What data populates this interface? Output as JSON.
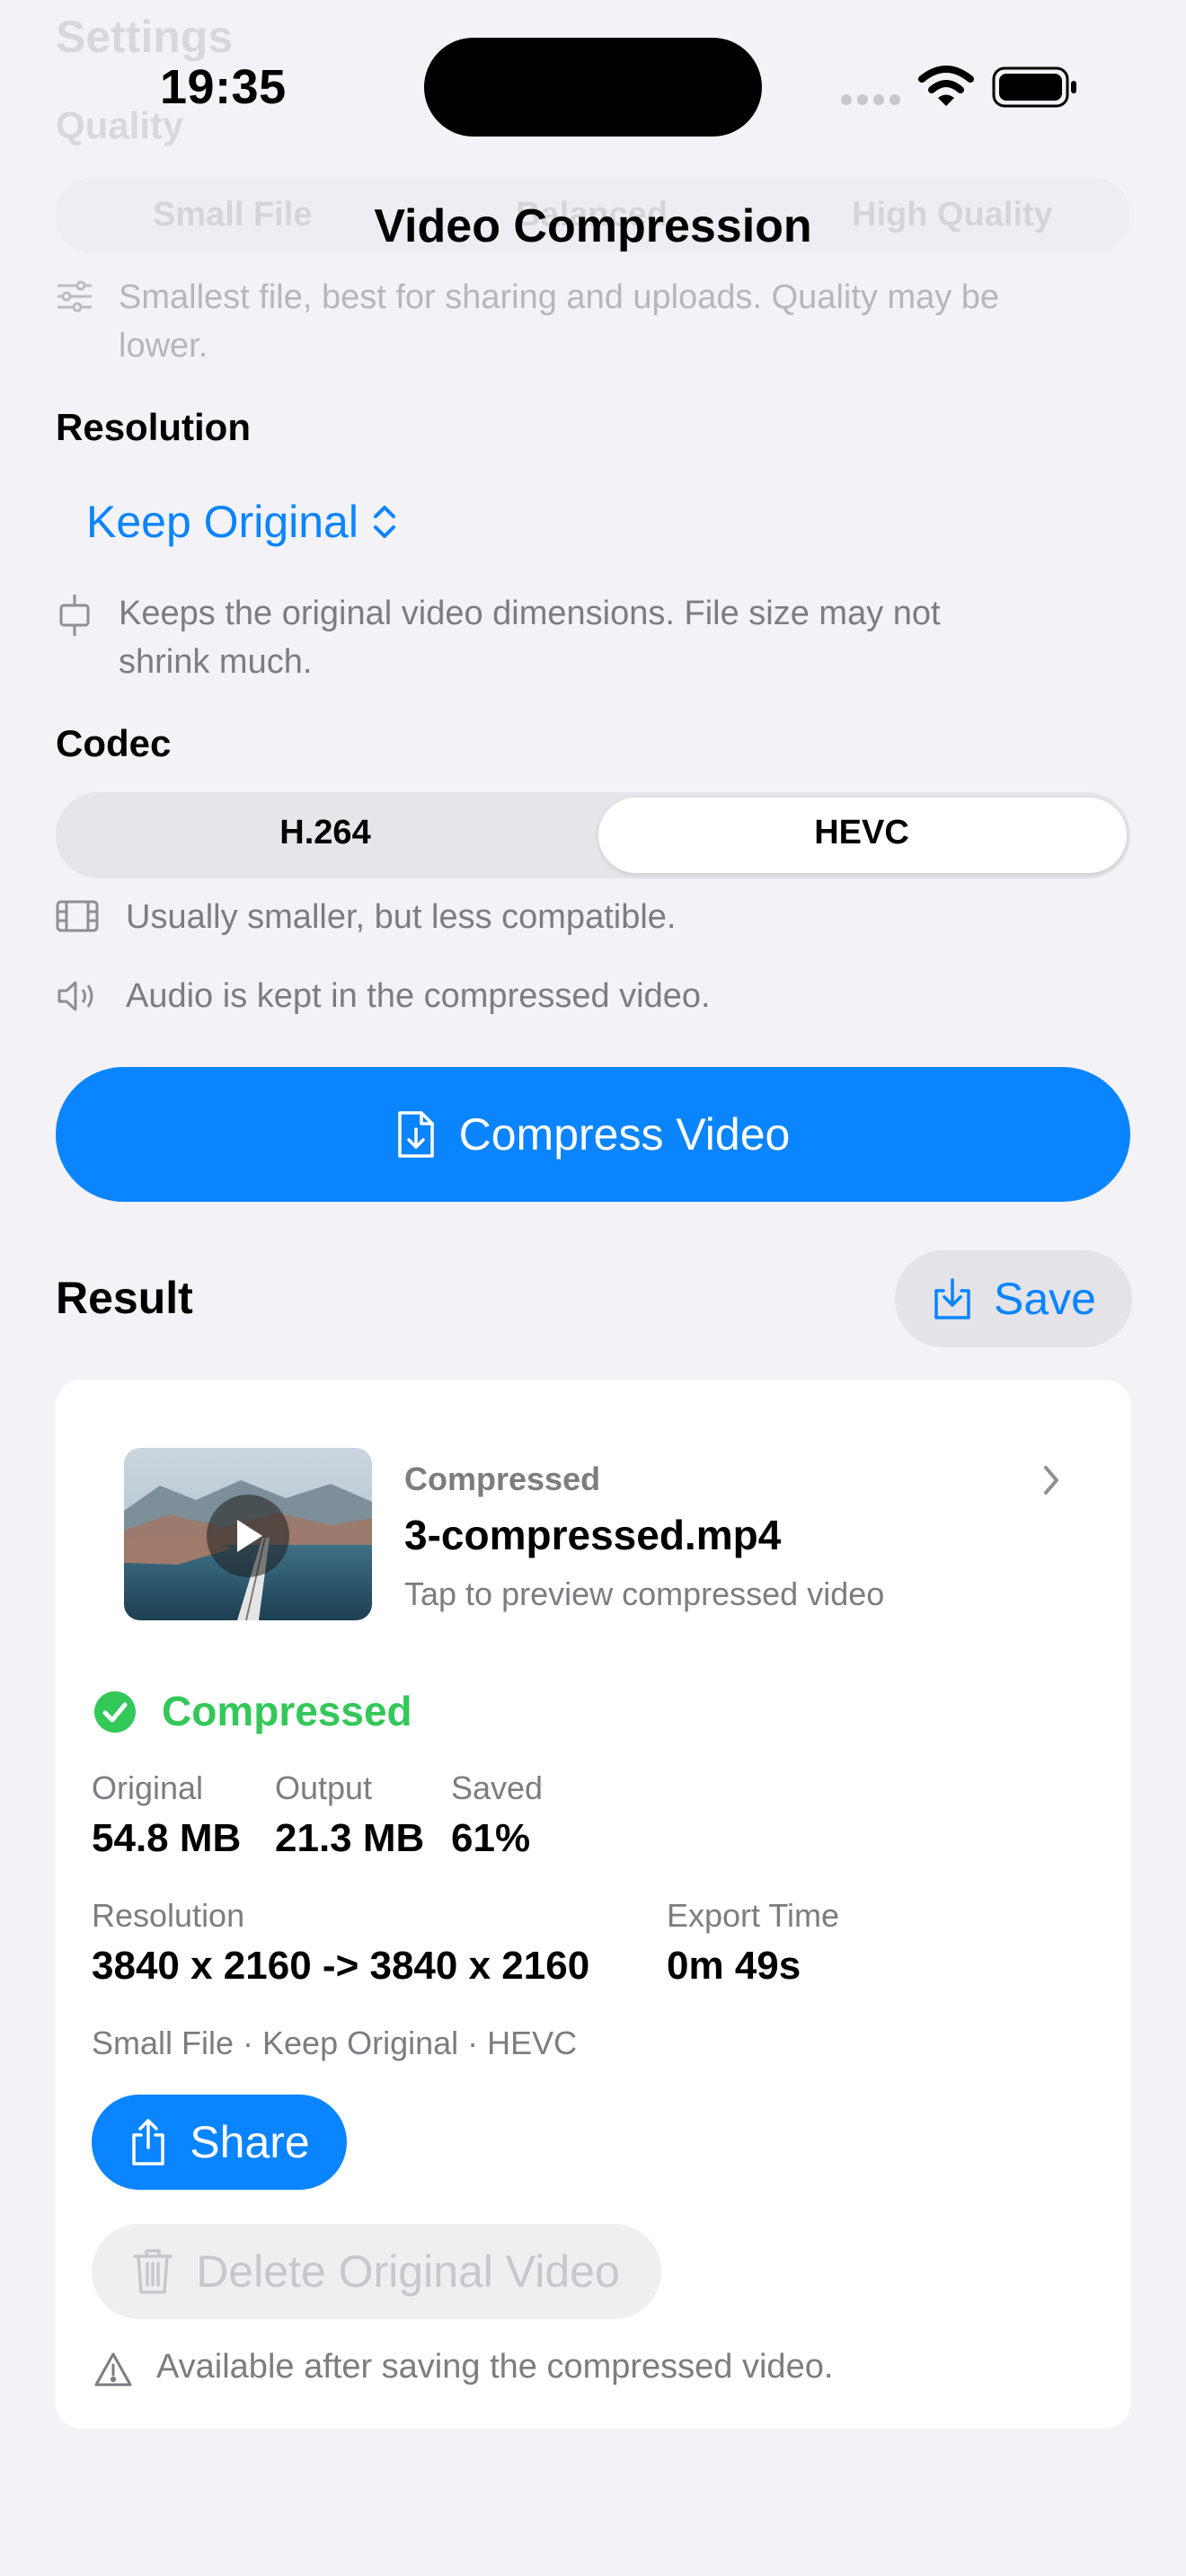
{
  "status_bar": {
    "time": "19:35"
  },
  "nav": {
    "title": "Video Compression"
  },
  "background_settings": {
    "title": "Settings",
    "quality_label": "Quality",
    "quality_options": [
      "Small File",
      "Balanced",
      "High Quality"
    ],
    "quality_hint": "Smallest file, best for sharing and uploads. Quality may be lower."
  },
  "resolution": {
    "label": "Resolution",
    "selected": "Keep Original",
    "hint_line1": "Keeps the original video dimensions. File size may not",
    "hint_line2": "shrink much."
  },
  "codec": {
    "label": "Codec",
    "options": [
      "H.264",
      "HEVC"
    ],
    "selected": "HEVC",
    "hint": "Usually smaller, but less compatible.",
    "audio_hint": "Audio is kept in the compressed video."
  },
  "compress_button": {
    "label": "Compress Video"
  },
  "result": {
    "label": "Result",
    "save_label": "Save",
    "file": {
      "status": "Compressed",
      "name": "3-compressed.mp4",
      "subtitle": "Tap to preview compressed video"
    },
    "status_text": "Compressed",
    "stats": {
      "original_label": "Original",
      "original_value": "54.8 MB",
      "output_label": "Output",
      "output_value": "21.3 MB",
      "saved_label": "Saved",
      "saved_value": "61%",
      "resolution_label": "Resolution",
      "resolution_value": "3840 x 2160 -> 3840 x 2160",
      "export_label": "Export Time",
      "export_value": "0m 49s"
    },
    "summary": "Small File · Keep Original · HEVC",
    "share_label": "Share",
    "delete_label": "Delete Original Video",
    "warning": "Available after saving the compressed video."
  },
  "colors": {
    "accent": "#0a84ff",
    "success": "#34c759",
    "background": "#f2f2f7"
  }
}
